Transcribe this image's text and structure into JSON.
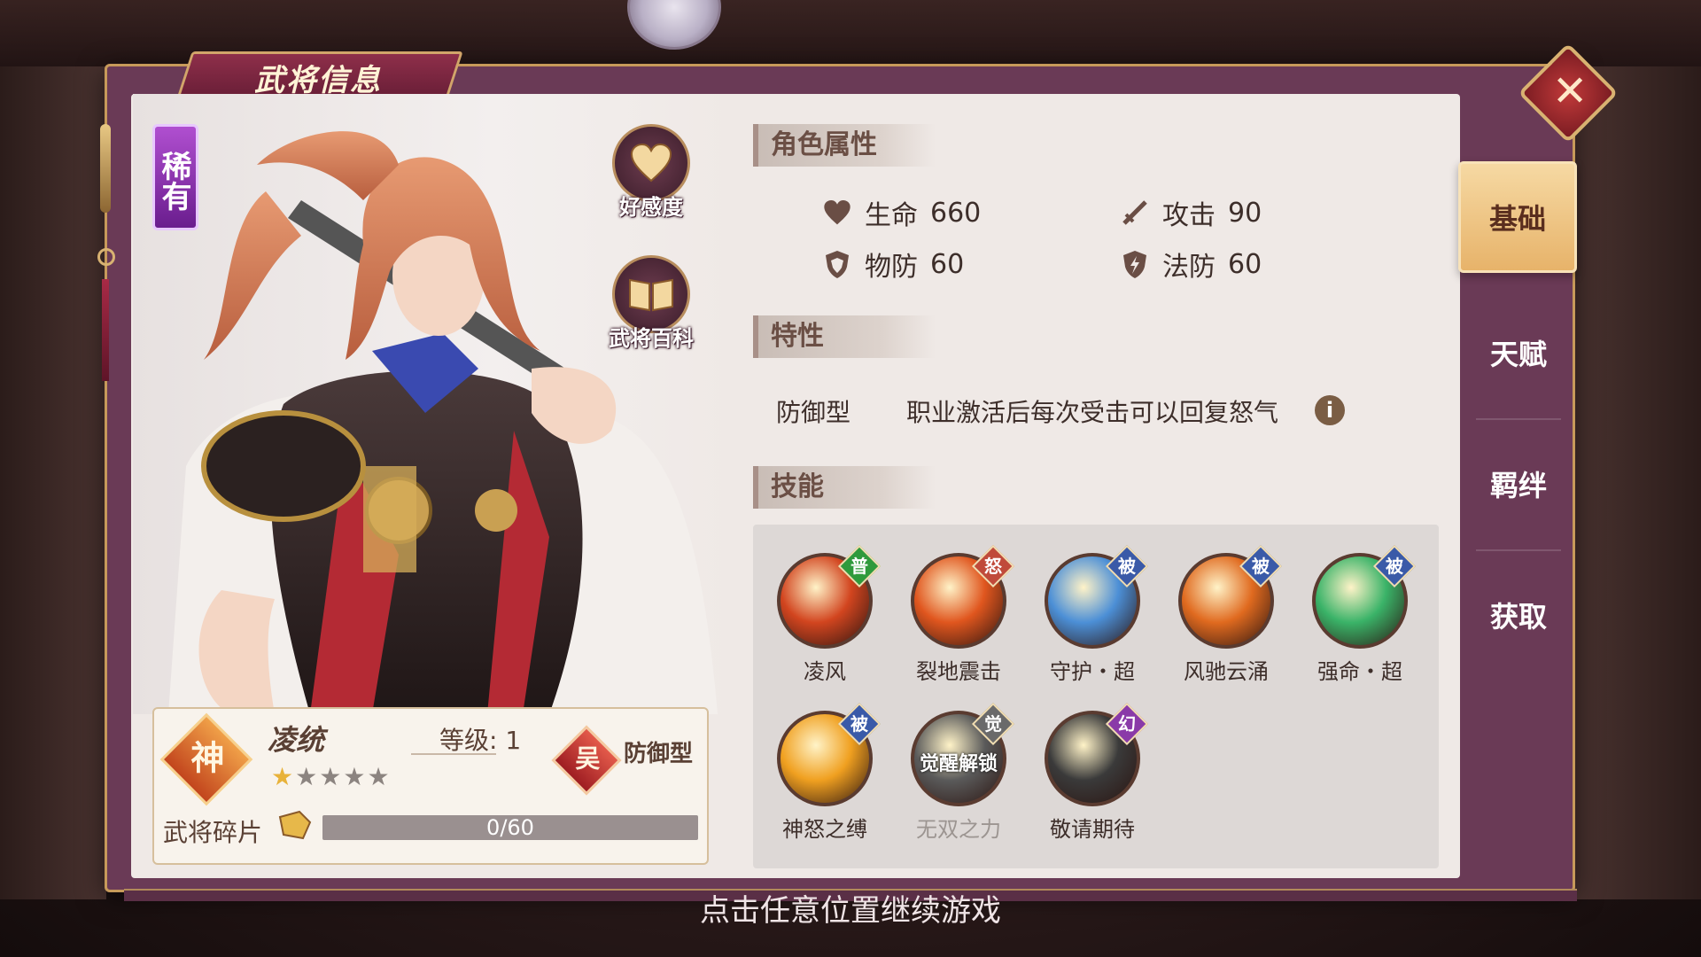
{
  "window": {
    "title": "武将信息"
  },
  "hero": {
    "rarity": "稀有",
    "name": "凌统",
    "level_label": "等级: 1",
    "god_badge": "神",
    "faction_badge": "吴",
    "type": "防御型",
    "stars_total": 5,
    "stars_filled": 1,
    "shard_label": "武将碎片",
    "shard_text": "0/60",
    "shard_progress": 0
  },
  "side_buttons": {
    "affection": "好感度",
    "encyclopedia": "武将百科"
  },
  "attributes": {
    "header": "角色属性",
    "hp": {
      "label": "生命",
      "value": "660"
    },
    "attack": {
      "label": "攻击",
      "value": "90"
    },
    "pdef": {
      "label": "物防",
      "value": "60"
    },
    "mdef": {
      "label": "法防",
      "value": "60"
    }
  },
  "traits": {
    "header": "特性",
    "type": "防御型",
    "description": "职业激活后每次受击可以回复怒气",
    "info_glyph": "i"
  },
  "skills": {
    "header": "技能",
    "items": [
      {
        "name": "凌风",
        "tag": "普",
        "tag_color": "#2f9a3c",
        "orb": "#d2451f"
      },
      {
        "name": "裂地震击",
        "tag": "怒",
        "tag_color": "#c04a3a",
        "orb": "#e0561e"
      },
      {
        "name": "守护・超",
        "tag": "被",
        "tag_color": "#3a5aa8",
        "orb": "#4c8fd6"
      },
      {
        "name": "风驰云涌",
        "tag": "被",
        "tag_color": "#3a5aa8",
        "orb": "#e06a1f"
      },
      {
        "name": "强命・超",
        "tag": "被",
        "tag_color": "#3a5aa8",
        "orb": "#3ab368"
      },
      {
        "name": "神怒之缚",
        "tag": "被",
        "tag_color": "#3a5aa8",
        "orb": "#f0a020"
      },
      {
        "name": "无双之力",
        "tag": "觉",
        "tag_color": "#6a6a6a",
        "orb": "#5a5a5a",
        "overlay": "觉醒解锁"
      },
      {
        "name": "敬请期待",
        "tag": "幻",
        "tag_color": "#8a3aa8",
        "orb": "#3a3a3a"
      }
    ]
  },
  "tabs": [
    "基础",
    "天赋",
    "羁绊",
    "获取"
  ],
  "footer": "点击任意位置继续游戏",
  "close_glyph": "✕"
}
